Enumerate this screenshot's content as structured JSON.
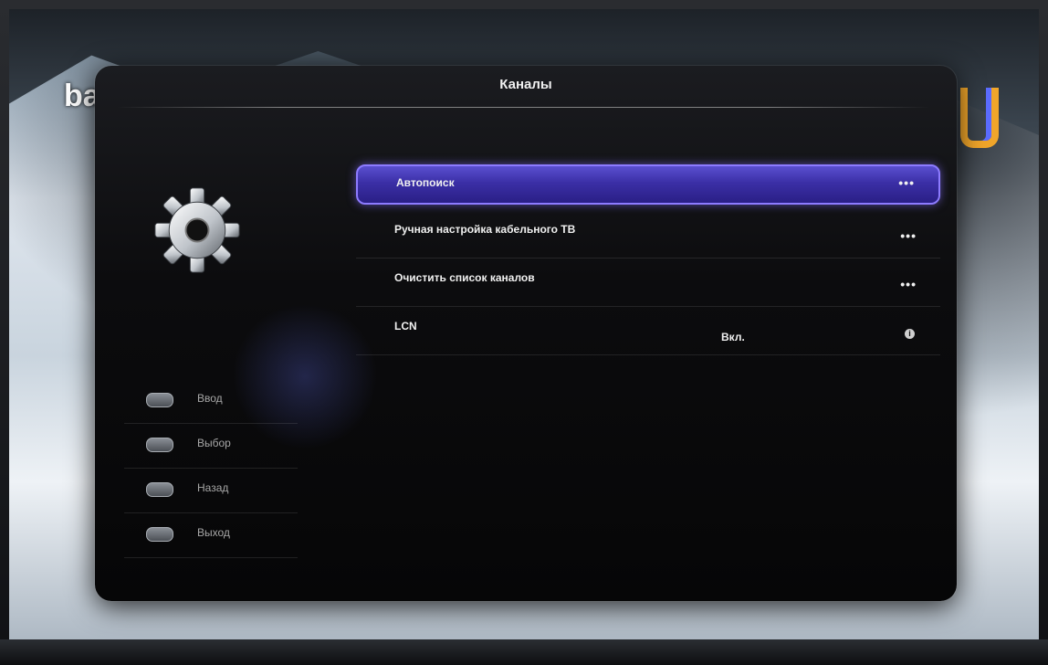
{
  "background": {
    "brand_fragment": "ba"
  },
  "menu": {
    "title": "Каналы",
    "items": [
      {
        "label": "Автопоиск",
        "value": "",
        "indicator": "•••",
        "selected": true
      },
      {
        "label": "Ручная настройка кабельного ТВ",
        "value": "",
        "indicator": "•••",
        "selected": false
      },
      {
        "label": "Очистить список каналов",
        "value": "",
        "indicator": "•••",
        "selected": false
      },
      {
        "label": "LCN",
        "value": "Вкл.",
        "indicator": "i",
        "selected": false
      }
    ]
  },
  "hints": [
    {
      "key_icon": "enter-key-icon",
      "label": "Ввод"
    },
    {
      "key_icon": "select-key-icon",
      "label": "Выбор"
    },
    {
      "key_icon": "back-key-icon",
      "label": "Назад"
    },
    {
      "key_icon": "exit-key-icon",
      "label": "Выход"
    }
  ],
  "colors": {
    "selection_top": "#5a4fd0",
    "selection_bottom": "#2a1f86",
    "selection_border": "#8d7bff",
    "panel": "#0c0c0e"
  }
}
